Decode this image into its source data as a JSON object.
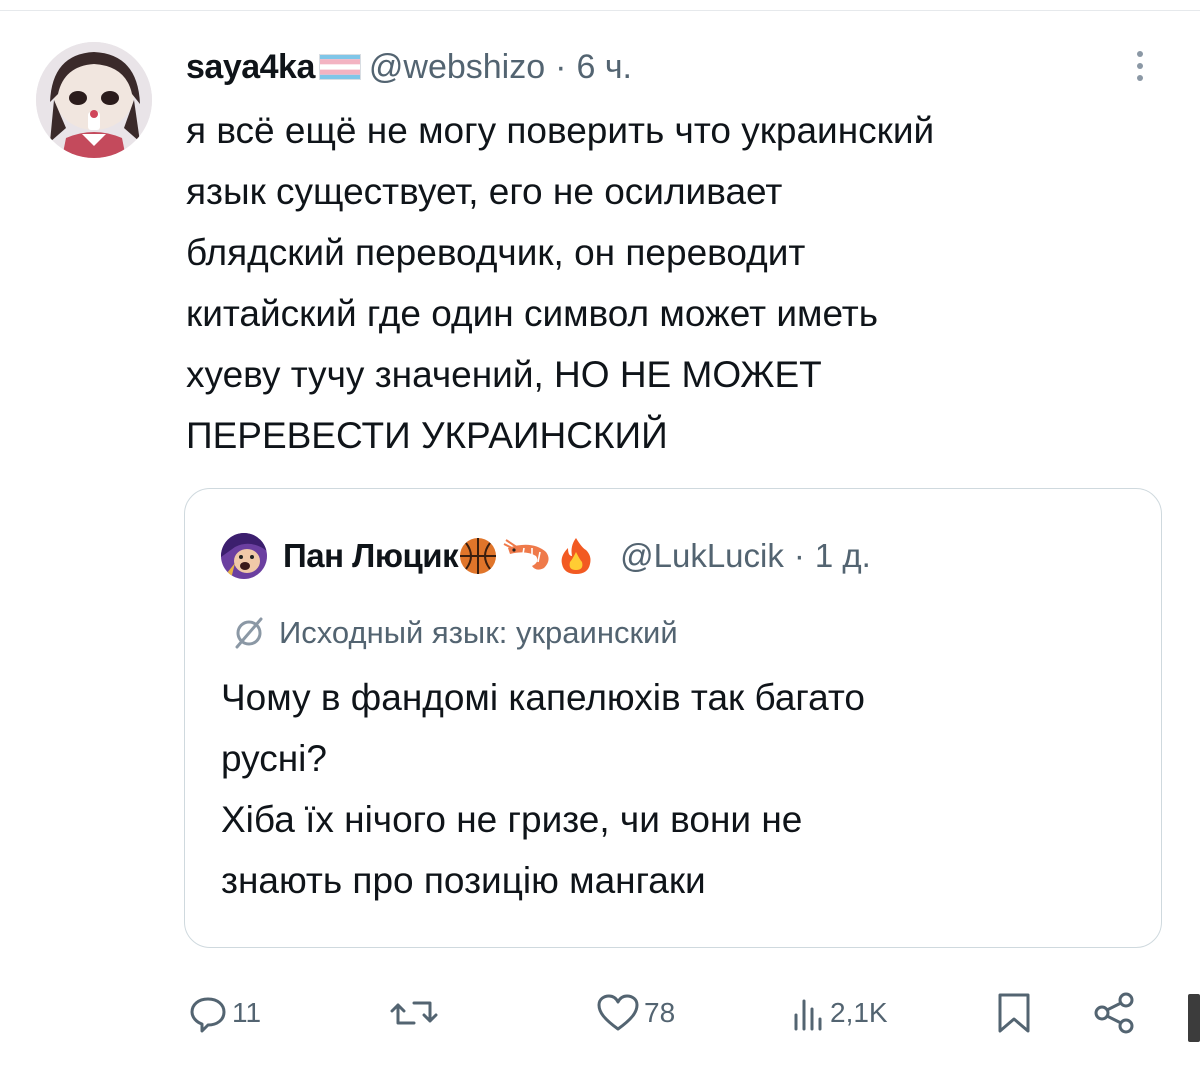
{
  "tweet": {
    "author": {
      "display_name": "saya4ka",
      "flag_icon": "transgender-flag-icon",
      "handle": "@webshizo",
      "separator": "·",
      "time": "6 ч."
    },
    "text_lines": [
      "я всё ещё не могу поверить что украинский",
      "язык существует, его не осиливает",
      "блядский переводчик, он переводит",
      "китайский где один символ может иметь",
      "хуеву тучу значений, НО НЕ МОЖЕТ",
      "ПЕРЕВЕСТИ УКРАИНСКИЙ"
    ]
  },
  "quoted": {
    "author": {
      "display_name": "Пан Люцик",
      "emojis": [
        "basketball-icon",
        "shrimp-icon",
        "fire-icon"
      ],
      "handle": "@LukLucik",
      "separator": "·",
      "time": "1 д."
    },
    "translation_label": "Исходный язык: украинский",
    "text_lines": [
      "Чому в фандомі капелюхів так багато",
      "русні?",
      "Хіба їх нічого не гризе, чи вони не",
      "знають про позицію мангаки"
    ]
  },
  "actions": {
    "replies": "11",
    "retweets": "",
    "likes": "78",
    "views": "2,1K"
  },
  "colors": {
    "text": "#0f1419",
    "secondary": "#536471",
    "border": "#cfd9de"
  }
}
